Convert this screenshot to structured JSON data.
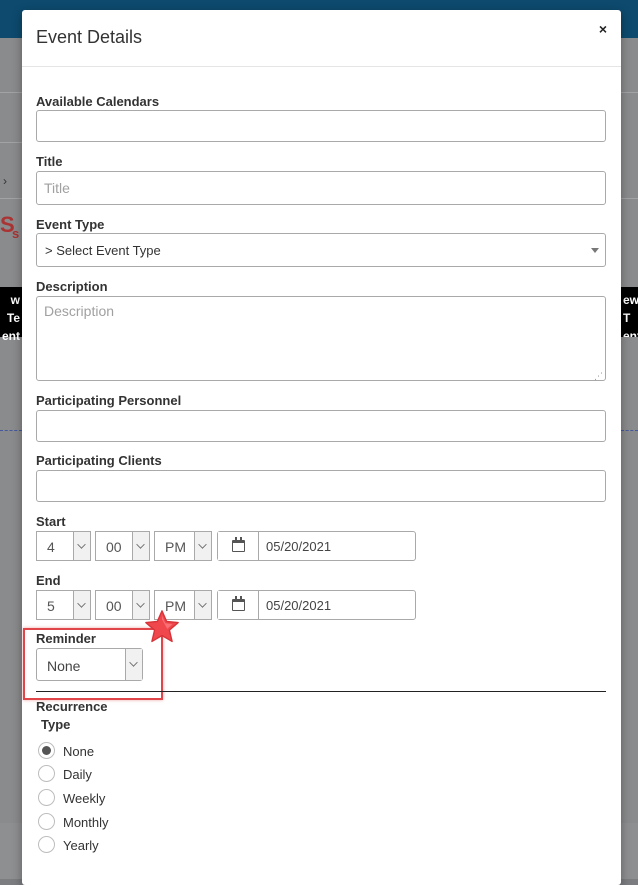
{
  "background": {
    "left_black_text": [
      "w Te",
      "ent"
    ],
    "right_black_text": [
      "ew T",
      "ent"
    ],
    "red_icon": "S",
    "red_text": "s"
  },
  "modal": {
    "title": "Event Details",
    "close_label": "×",
    "available_calendars": {
      "label": "Available Calendars",
      "value": ""
    },
    "title_field": {
      "label": "Title",
      "placeholder": "Title",
      "value": ""
    },
    "event_type": {
      "label": "Event Type",
      "selected": "> Select Event Type"
    },
    "description": {
      "label": "Description",
      "placeholder": "Description"
    },
    "participating_personnel": {
      "label": "Participating Personnel",
      "value": ""
    },
    "participating_clients": {
      "label": "Participating Clients",
      "value": ""
    },
    "start": {
      "label": "Start",
      "hour": "4",
      "minute": "00",
      "ampm": "PM",
      "date": "05/20/2021"
    },
    "end": {
      "label": "End",
      "hour": "5",
      "minute": "00",
      "ampm": "PM",
      "date": "05/20/2021"
    },
    "reminder": {
      "label": "Reminder",
      "selected": "None"
    },
    "recurrence": {
      "label_line1": "Recurrence",
      "label_line2": "Type",
      "options": [
        {
          "label": "None",
          "checked": true
        },
        {
          "label": "Daily",
          "checked": false
        },
        {
          "label": "Weekly",
          "checked": false
        },
        {
          "label": "Monthly",
          "checked": false
        },
        {
          "label": "Yearly",
          "checked": false
        }
      ]
    }
  },
  "colors": {
    "header_bar": "#0d4a6e",
    "highlight_border": "#e0454a",
    "star_fill": "#f0474d"
  },
  "icons": [
    "close-icon",
    "calendar-icon",
    "chevron-down-icon",
    "star-icon",
    "resize-grip-icon"
  ]
}
